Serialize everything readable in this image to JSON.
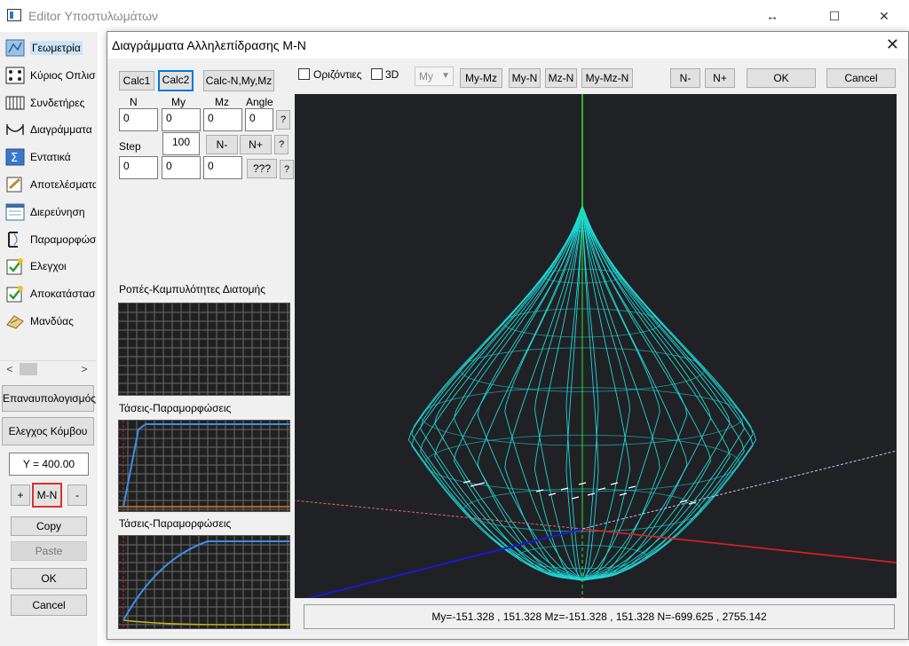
{
  "window": {
    "title": "Editor Υποστυλωμάτων",
    "restore_glyph": "↔",
    "maximize_glyph": "☐",
    "close_glyph": "✕"
  },
  "sidebar": {
    "items": [
      {
        "label": "Γεωμετρία",
        "icon": "geometry-icon",
        "selected": true
      },
      {
        "label": "Κύριος Οπλισμός",
        "icon": "rebar-icon"
      },
      {
        "label": "Συνδετήρες",
        "icon": "stirrups-icon"
      },
      {
        "label": "Διαγράμματα",
        "icon": "diagrams-icon"
      },
      {
        "label": "Εντατικά",
        "icon": "sigma-icon"
      },
      {
        "label": "Αποτελέσματα",
        "icon": "results-icon"
      },
      {
        "label": "Διερεύνηση",
        "icon": "investigation-icon"
      },
      {
        "label": "Παραμορφώσεις",
        "icon": "deformations-icon"
      },
      {
        "label": "Ελεγχοι",
        "icon": "checks-icon"
      },
      {
        "label": "Αποκατάσταση",
        "icon": "restoration-icon"
      },
      {
        "label": "Μανδύας",
        "icon": "jacket-icon"
      }
    ],
    "scroll_left": "<",
    "scroll_right": ">",
    "recalc_label": "Επαναυπολογισμός",
    "node_check_label": "Ελεγχος Κόμβου",
    "y_value": "Y = 400.00",
    "plus_label": "+",
    "mn_label": "M-N",
    "minus_label": "-",
    "copy_label": "Copy",
    "paste_label": "Paste",
    "ok_label": "OK",
    "cancel_label": "Cancel"
  },
  "dialog": {
    "title": "Διαγράμματα Αλληλεπίδρασης M-N",
    "close_glyph": "✕",
    "calc1_label": "Calc1",
    "calc2_label": "Calc2",
    "calc_nmm_label": "Calc-N,My,Mz",
    "headers": {
      "n": "N",
      "my": "My",
      "mz": "Mz",
      "angle": "Angle"
    },
    "values": {
      "n": "0",
      "my": "0",
      "mz": "0",
      "angle": "0"
    },
    "question_label": "?",
    "step_label": "Step",
    "step_value": "100",
    "n_minus_label": "N-",
    "n_plus_label": "N+",
    "row3": {
      "a": "0",
      "b": "0",
      "c": "0"
    },
    "qqq_label": "???",
    "section_forces_label": "Ροπές-Καμπυλότητες Διατομής",
    "stress_strain_label_1": "Τάσεις-Παραμορφώσεις",
    "stress_strain_label_2": "Τάσεις-Παραμορφώσεις",
    "horizontal_label": "Οριζόντιες",
    "three_d_label": "3D",
    "axis_combo_value": "My",
    "view_buttons": [
      "My-Mz",
      "My-N",
      "Mz-N",
      "My-Mz-N"
    ],
    "top_n_minus": "N-",
    "top_n_plus": "N+",
    "ok_label": "OK",
    "cancel_label": "Cancel",
    "status_text": "My=-151.328 , 151.328 Mz=-151.328 , 151.328 N=-699.625 , 2755.142"
  },
  "colors": {
    "mesh": "#1fd6d6",
    "axis_n": "#2ee82e",
    "axis_red": "#d42020",
    "axis_blue": "#1a1ad4",
    "plot_bg": "#202124",
    "curve_blue": "#3b8ee8",
    "accent_focus": "#0078d7",
    "highlight_red": "#d9322c"
  },
  "chart_data": {
    "type": "3d-surface",
    "title": "",
    "my_range": [
      -151.328,
      151.328
    ],
    "mz_range": [
      -151.328,
      151.328
    ],
    "n_range": [
      -699.625,
      2755.142
    ]
  }
}
